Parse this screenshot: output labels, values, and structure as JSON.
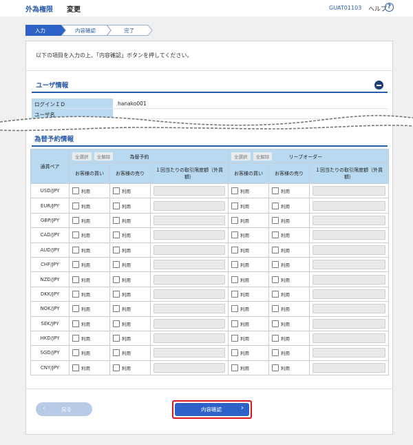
{
  "header": {
    "brand": "外為権限",
    "screen_title": "変更",
    "screen_id": "GUAT01103",
    "help_label": "ヘルプ",
    "help_icon": "question-circle-icon"
  },
  "steps": [
    {
      "label": "入力",
      "active": true
    },
    {
      "label": "内容確認",
      "active": false
    },
    {
      "label": "完了",
      "active": false
    }
  ],
  "instruction": "以下の項目を入力の上、「内容確認」ボタンを押してください。",
  "user_info": {
    "title": "ユーザ情報",
    "rows": [
      {
        "label": "ログインＩＤ",
        "value": "hanako001"
      },
      {
        "label": "ユーザ名",
        "value": ""
      }
    ]
  },
  "fx": {
    "title": "為替予約情報",
    "pair_header": "通貨ペア",
    "select_all": "全選択",
    "deselect_all": "全解除",
    "groups": [
      "為替予約",
      "リーブオーダー"
    ],
    "col_buy": "お客様の買い",
    "col_sell": "お客様の売り",
    "col_limit": "１回当たりの取引限度額（外貨額）",
    "use_label": "利用",
    "pairs": [
      "USD/JPY",
      "EUR/JPY",
      "GBP/JPY",
      "CAD/JPY",
      "AUD/JPY",
      "CHF/JPY",
      "NZD/JPY",
      "DKK/JPY",
      "NOK/JPY",
      "SEK/JPY",
      "HKD/JPY",
      "SGD/JPY",
      "CNY/JPY"
    ]
  },
  "footer": {
    "back_label": "戻る",
    "confirm_label": "内容確認"
  },
  "colors": {
    "brand": "#2a5caa",
    "header_cell": "#b9d9f1",
    "primary_button": "#2f62c9",
    "highlight_border": "#e0141e"
  }
}
